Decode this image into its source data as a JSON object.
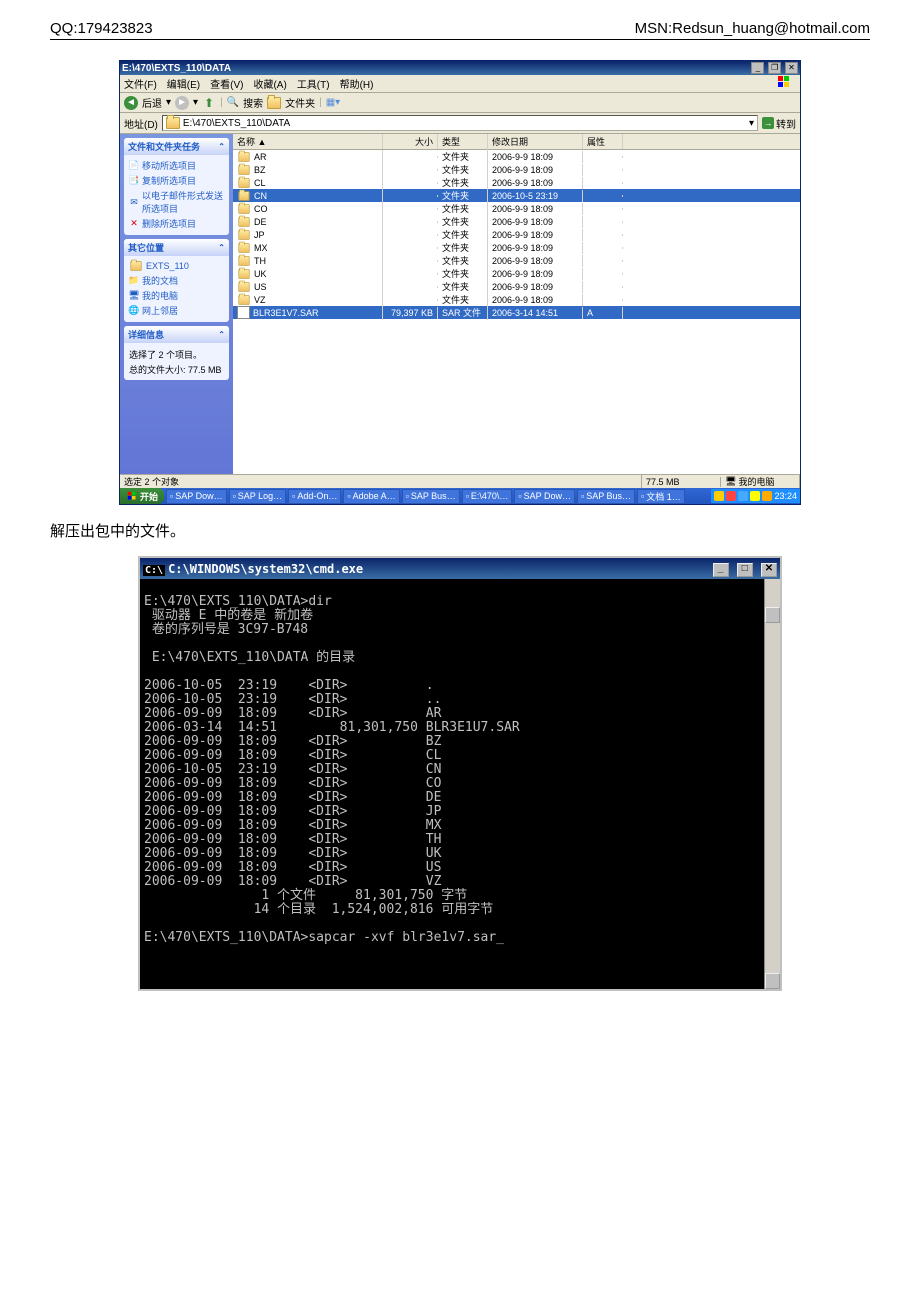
{
  "header": {
    "left": "QQ:179423823",
    "right": "MSN:Redsun_huang@hotmail.com"
  },
  "explorer": {
    "title": "E:\\470\\EXTS_110\\DATA",
    "menu": [
      "文件(F)",
      "编辑(E)",
      "查看(V)",
      "收藏(A)",
      "工具(T)",
      "帮助(H)"
    ],
    "toolbar": {
      "back": "后退",
      "search": "搜索",
      "folders": "文件夹"
    },
    "address_label": "地址(D)",
    "address": "E:\\470\\EXTS_110\\DATA",
    "go": "转到",
    "columns": {
      "name": "名称 ▲",
      "size": "大小",
      "type": "类型",
      "date": "修改日期",
      "attr": "属性"
    },
    "side_tasks": {
      "title": "文件和文件夹任务",
      "items": [
        "移动所选项目",
        "复制所选项目",
        "以电子邮件形式发送所选项目",
        "删除所选项目"
      ]
    },
    "side_places": {
      "title": "其它位置",
      "items": [
        "EXTS_110",
        "我的文档",
        "我的电脑",
        "网上邻居"
      ]
    },
    "side_details": {
      "title": "详细信息",
      "line1": "选择了 2 个项目。",
      "line2": "总的文件大小: 77.5 MB"
    },
    "files": [
      {
        "name": "AR",
        "size": "",
        "type": "文件夹",
        "date": "2006-9-9 18:09",
        "attr": "",
        "icon": "folder",
        "sel": false
      },
      {
        "name": "BZ",
        "size": "",
        "type": "文件夹",
        "date": "2006-9-9 18:09",
        "attr": "",
        "icon": "folder",
        "sel": false
      },
      {
        "name": "CL",
        "size": "",
        "type": "文件夹",
        "date": "2006-9-9 18:09",
        "attr": "",
        "icon": "folder",
        "sel": false
      },
      {
        "name": "CN",
        "size": "",
        "type": "文件夹",
        "date": "2006-10-5 23:19",
        "attr": "",
        "icon": "folder",
        "sel": true
      },
      {
        "name": "CO",
        "size": "",
        "type": "文件夹",
        "date": "2006-9-9 18:09",
        "attr": "",
        "icon": "folder",
        "sel": false
      },
      {
        "name": "DE",
        "size": "",
        "type": "文件夹",
        "date": "2006-9-9 18:09",
        "attr": "",
        "icon": "folder",
        "sel": false
      },
      {
        "name": "JP",
        "size": "",
        "type": "文件夹",
        "date": "2006-9-9 18:09",
        "attr": "",
        "icon": "folder",
        "sel": false
      },
      {
        "name": "MX",
        "size": "",
        "type": "文件夹",
        "date": "2006-9-9 18:09",
        "attr": "",
        "icon": "folder",
        "sel": false
      },
      {
        "name": "TH",
        "size": "",
        "type": "文件夹",
        "date": "2006-9-9 18:09",
        "attr": "",
        "icon": "folder",
        "sel": false
      },
      {
        "name": "UK",
        "size": "",
        "type": "文件夹",
        "date": "2006-9-9 18:09",
        "attr": "",
        "icon": "folder",
        "sel": false
      },
      {
        "name": "US",
        "size": "",
        "type": "文件夹",
        "date": "2006-9-9 18:09",
        "attr": "",
        "icon": "folder",
        "sel": false
      },
      {
        "name": "VZ",
        "size": "",
        "type": "文件夹",
        "date": "2006-9-9 18:09",
        "attr": "",
        "icon": "folder",
        "sel": false
      },
      {
        "name": "BLR3E1V7.SAR",
        "size": "79,397 KB",
        "type": "SAR 文件",
        "date": "2006-3-14 14:51",
        "attr": "A",
        "icon": "file",
        "sel": true
      }
    ],
    "status": {
      "text": "选定 2 个对象",
      "size": "77.5 MB",
      "loc": "我的电脑"
    },
    "taskbar": {
      "start": "开始",
      "tasks": [
        "SAP Dow…",
        "SAP Log…",
        "Add-On…",
        "Adobe A…",
        "SAP Bus…",
        "E:\\470\\…",
        "SAP Dow…",
        "SAP Bus…",
        "文档 1…"
      ],
      "time": "23:24"
    }
  },
  "body_text": "解压出包中的文件。",
  "cmd": {
    "title": "C:\\WINDOWS\\system32\\cmd.exe",
    "lines": "E:\\470\\EXTS_110\\DATA>dir\n 驱动器 E 中的卷是 新加卷\n 卷的序列号是 3C97-B748\n\n E:\\470\\EXTS_110\\DATA 的目录\n\n2006-10-05  23:19    <DIR>          .\n2006-10-05  23:19    <DIR>          ..\n2006-09-09  18:09    <DIR>          AR\n2006-03-14  14:51        81,301,750 BLR3E1U7.SAR\n2006-09-09  18:09    <DIR>          BZ\n2006-09-09  18:09    <DIR>          CL\n2006-10-05  23:19    <DIR>          CN\n2006-09-09  18:09    <DIR>          CO\n2006-09-09  18:09    <DIR>          DE\n2006-09-09  18:09    <DIR>          JP\n2006-09-09  18:09    <DIR>          MX\n2006-09-09  18:09    <DIR>          TH\n2006-09-09  18:09    <DIR>          UK\n2006-09-09  18:09    <DIR>          US\n2006-09-09  18:09    <DIR>          VZ\n               1 个文件     81,301,750 字节\n              14 个目录  1,524,002,816 可用字节\n\nE:\\470\\EXTS_110\\DATA>sapcar -xvf blr3e1v7.sar_"
  }
}
